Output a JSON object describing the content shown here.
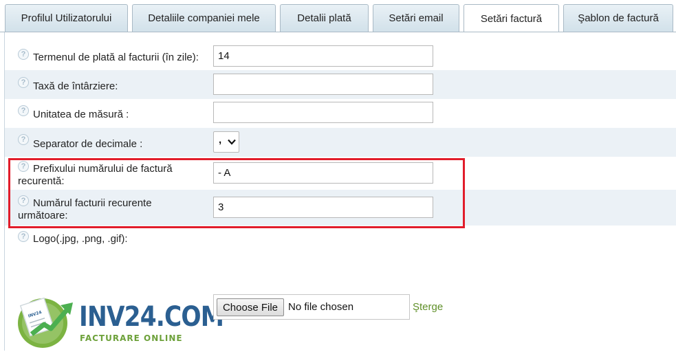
{
  "tabs": [
    {
      "label": "Profilul Utilizatorului"
    },
    {
      "label": "Detaliile companiei mele"
    },
    {
      "label": "Detalii plată"
    },
    {
      "label": "Setări email"
    },
    {
      "label": "Setări factură"
    },
    {
      "label": "Şablon de factură"
    }
  ],
  "active_tab": "Setări factură",
  "help_glyph": "?",
  "fields": {
    "payment_term": {
      "label": "Termenul de plată al facturii (în zile):",
      "value": "14"
    },
    "late_fee": {
      "label": "Taxă de întârziere:",
      "value": ""
    },
    "unit": {
      "label": "Unitatea de măsură :",
      "value": ""
    },
    "decimal_separator": {
      "label": "Separator de decimale :",
      "selected": ","
    },
    "recurring_prefix": {
      "label_line1": "Prefixului numărului de factură",
      "label_line2": "recurentă:",
      "value": "- A"
    },
    "recurring_next_number": {
      "label_line1": "Numărul facturii recurente",
      "label_line2": "următoare:",
      "value": "3"
    },
    "logo": {
      "label": "Logo(.jpg, .png, .gif):"
    }
  },
  "file_input": {
    "button_label": "Choose File",
    "status": "No file chosen"
  },
  "delete_link": "Şterge",
  "logo_image": {
    "brand_text": "INV24.COM",
    "subtitle": "FACTURARE ONLINE",
    "page_glyph_text": "INV24"
  },
  "colors": {
    "highlight_border": "#e11c2a",
    "link": "#5f8f28",
    "brand_blue": "#2b5f91",
    "brand_green": "#6da13a"
  }
}
